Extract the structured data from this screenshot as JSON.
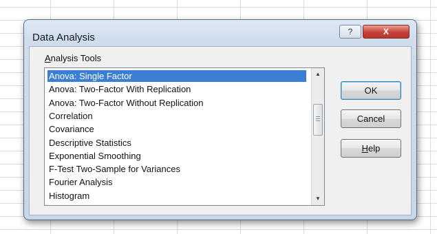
{
  "dialog": {
    "title": "Data Analysis",
    "title_help_glyph": "?",
    "title_close_glyph": "X",
    "group_label_accel": "A",
    "group_label_rest": "nalysis Tools",
    "analysis_tools": [
      {
        "label": "Anova: Single Factor",
        "selected": true
      },
      {
        "label": "Anova: Two-Factor With Replication",
        "selected": false
      },
      {
        "label": "Anova: Two-Factor Without Replication",
        "selected": false
      },
      {
        "label": "Correlation",
        "selected": false
      },
      {
        "label": "Covariance",
        "selected": false
      },
      {
        "label": "Descriptive Statistics",
        "selected": false
      },
      {
        "label": "Exponential Smoothing",
        "selected": false
      },
      {
        "label": "F-Test Two-Sample for Variances",
        "selected": false
      },
      {
        "label": "Fourier Analysis",
        "selected": false
      },
      {
        "label": "Histogram",
        "selected": false
      }
    ],
    "scroll_up_glyph": "▲",
    "scroll_down_glyph": "▼",
    "ok_label": "OK",
    "cancel_label": "Cancel",
    "help_label_accel": "H",
    "help_label_rest": "elp"
  },
  "colors": {
    "selection": "#3b7fd4",
    "close_button": "#c6433a"
  },
  "icons": {
    "help": "help-icon",
    "close": "close-icon",
    "scroll_up": "chevron-up-icon",
    "scroll_down": "chevron-down-icon"
  }
}
